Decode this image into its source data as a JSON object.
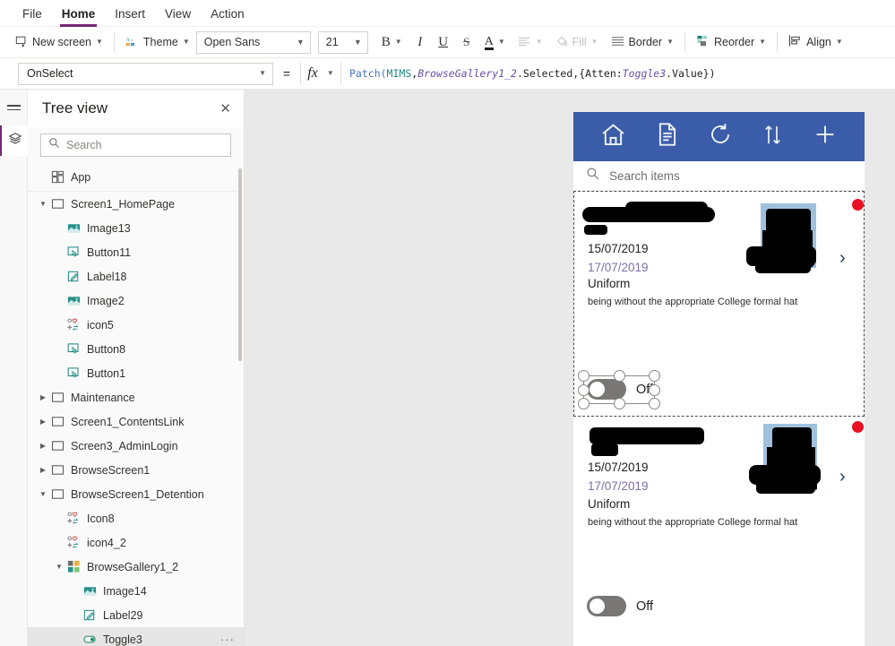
{
  "menubar": {
    "items": [
      {
        "label": "File",
        "active": false
      },
      {
        "label": "Home",
        "active": true
      },
      {
        "label": "Insert",
        "active": false
      },
      {
        "label": "View",
        "active": false
      },
      {
        "label": "Action",
        "active": false
      }
    ]
  },
  "ribbon": {
    "new_screen": "New screen",
    "theme": "Theme",
    "font_family": "Open Sans",
    "font_size": "21",
    "bold": "B",
    "italic": "I",
    "underline": "U",
    "strikethrough": "S",
    "font_color": "A",
    "align": "Align text",
    "fill": "Fill",
    "border": "Border",
    "reorder": "Reorder",
    "align_btn": "Align"
  },
  "formula_bar": {
    "property": "OnSelect",
    "equals": "=",
    "fx": "fx",
    "formula_tokens": [
      {
        "text": "Patch(",
        "kind": "fn"
      },
      {
        "text": "MIMS",
        "kind": "src"
      },
      {
        "text": ",",
        "kind": "plain"
      },
      {
        "text": "BrowseGallery1_2",
        "kind": "ctrl"
      },
      {
        "text": ".Selected,{Atten:",
        "kind": "plain"
      },
      {
        "text": "Toggle3",
        "kind": "ctrl"
      },
      {
        "text": ".Value})",
        "kind": "plain"
      }
    ],
    "formula_text": "Patch(MIMS,BrowseGallery1_2.Selected,{Atten:Toggle3.Value})"
  },
  "tree_panel": {
    "title": "Tree view",
    "close": "✕",
    "search_placeholder": "Search",
    "items": [
      {
        "label": "App",
        "indent": 0,
        "twisty": "",
        "icon": "app",
        "selected": false,
        "ellipsis": false,
        "divider_after": true
      },
      {
        "label": "Screen1_HomePage",
        "indent": 0,
        "twisty": "v",
        "icon": "screen",
        "selected": false,
        "ellipsis": false,
        "divider_after": false
      },
      {
        "label": "Image13",
        "indent": 1,
        "twisty": "",
        "icon": "image",
        "selected": false,
        "ellipsis": false,
        "divider_after": false
      },
      {
        "label": "Button11",
        "indent": 1,
        "twisty": "",
        "icon": "button",
        "selected": false,
        "ellipsis": false,
        "divider_after": false
      },
      {
        "label": "Label18",
        "indent": 1,
        "twisty": "",
        "icon": "label",
        "selected": false,
        "ellipsis": false,
        "divider_after": false
      },
      {
        "label": "Image2",
        "indent": 1,
        "twisty": "",
        "icon": "image",
        "selected": false,
        "ellipsis": false,
        "divider_after": false
      },
      {
        "label": "icon5",
        "indent": 1,
        "twisty": "",
        "icon": "icon",
        "selected": false,
        "ellipsis": false,
        "divider_after": false
      },
      {
        "label": "Button8",
        "indent": 1,
        "twisty": "",
        "icon": "button",
        "selected": false,
        "ellipsis": false,
        "divider_after": false
      },
      {
        "label": "Button1",
        "indent": 1,
        "twisty": "",
        "icon": "button",
        "selected": false,
        "ellipsis": false,
        "divider_after": false
      },
      {
        "label": "Maintenance",
        "indent": 0,
        "twisty": ">",
        "icon": "screen",
        "selected": false,
        "ellipsis": false,
        "divider_after": false
      },
      {
        "label": "Screen1_ContentsLink",
        "indent": 0,
        "twisty": ">",
        "icon": "screen",
        "selected": false,
        "ellipsis": false,
        "divider_after": false
      },
      {
        "label": "Screen3_AdminLogin",
        "indent": 0,
        "twisty": ">",
        "icon": "screen",
        "selected": false,
        "ellipsis": false,
        "divider_after": false
      },
      {
        "label": "BrowseScreen1",
        "indent": 0,
        "twisty": ">",
        "icon": "screen",
        "selected": false,
        "ellipsis": false,
        "divider_after": false
      },
      {
        "label": "BrowseScreen1_Detention",
        "indent": 0,
        "twisty": "v",
        "icon": "screen",
        "selected": false,
        "ellipsis": false,
        "divider_after": false
      },
      {
        "label": "Icon8",
        "indent": 1,
        "twisty": "",
        "icon": "icon",
        "selected": false,
        "ellipsis": false,
        "divider_after": false
      },
      {
        "label": "icon4_2",
        "indent": 1,
        "twisty": "",
        "icon": "icon",
        "selected": false,
        "ellipsis": false,
        "divider_after": false
      },
      {
        "label": "BrowseGallery1_2",
        "indent": 1,
        "twisty": "v",
        "icon": "gallery",
        "selected": false,
        "ellipsis": false,
        "divider_after": false
      },
      {
        "label": "Image14",
        "indent": 2,
        "twisty": "",
        "icon": "image",
        "selected": false,
        "ellipsis": false,
        "divider_after": false
      },
      {
        "label": "Label29",
        "indent": 2,
        "twisty": "",
        "icon": "label",
        "selected": false,
        "ellipsis": false,
        "divider_after": false
      },
      {
        "label": "Toggle3",
        "indent": 2,
        "twisty": "",
        "icon": "toggle",
        "selected": true,
        "ellipsis": true,
        "divider_after": false
      }
    ]
  },
  "app_preview": {
    "header_color": "#3b5ca8",
    "header_icons": [
      "home-icon",
      "document-icon",
      "refresh-icon",
      "sort-icon",
      "add-icon"
    ],
    "search_placeholder": "Search items",
    "gallery": [
      {
        "date_created": "15/07/2019",
        "date_due": "17/07/2019",
        "category": "Uniform",
        "description": "being without the appropriate College formal hat",
        "toggle_label": "Off",
        "toggle_on": false,
        "selected": true,
        "status_dot_color": "#e81123"
      },
      {
        "date_created": "15/07/2019",
        "date_due": "17/07/2019",
        "category": "Uniform",
        "description": "being without the appropriate College formal hat",
        "toggle_label": "Off",
        "toggle_on": false,
        "selected": false,
        "status_dot_color": "#e81123"
      }
    ]
  },
  "colors": {
    "accent_purple": "#742774",
    "app_blue": "#3b5ca8",
    "due_date": "#7b6fa8",
    "alert_red": "#e81123",
    "toggle_off": "#797775"
  }
}
